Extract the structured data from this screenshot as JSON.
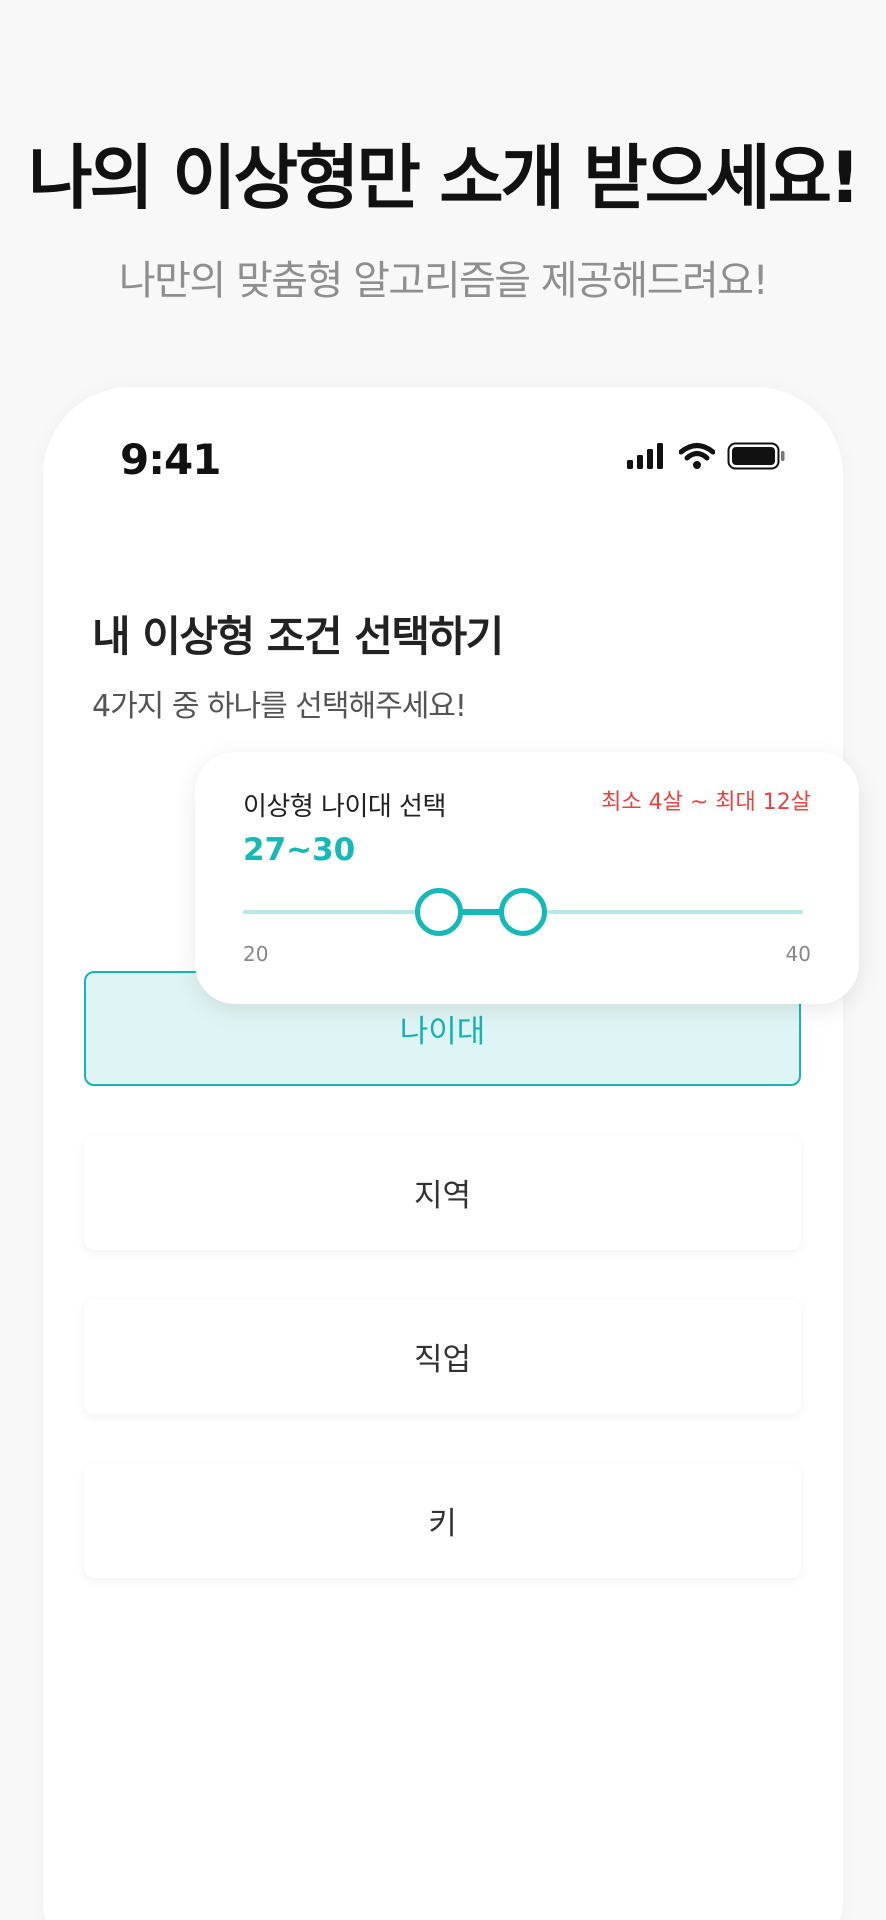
{
  "hero": {
    "title": "나의 이상형만 소개 받으세요!",
    "subtitle": "나만의 맞춤형 알고리즘을 제공해드려요!"
  },
  "status_bar": {
    "time": "9:41",
    "icons": [
      "cellular-signal-icon",
      "wifi-icon",
      "battery-icon"
    ]
  },
  "screen": {
    "title": "내 이상형 조건 선택하기",
    "subtitle": "4가지 중 하나를 선택해주세요!",
    "options": [
      {
        "label": "나이대",
        "selected": true
      },
      {
        "label": "지역",
        "selected": false
      },
      {
        "label": "직업",
        "selected": false
      },
      {
        "label": "키",
        "selected": false
      }
    ]
  },
  "age_popup": {
    "title": "이상형 나이대 선택",
    "range_note": "최소 4살 ~ 최대 12살",
    "value_text": "27~30",
    "slider": {
      "min": 20,
      "max": 40,
      "min_label": "20",
      "max_label": "40",
      "low": 27,
      "high": 30
    }
  },
  "colors": {
    "accent": "#16b8b8",
    "accent_light": "#dff4f4",
    "warning": "#ef4040",
    "background": "#f8f8f8"
  }
}
